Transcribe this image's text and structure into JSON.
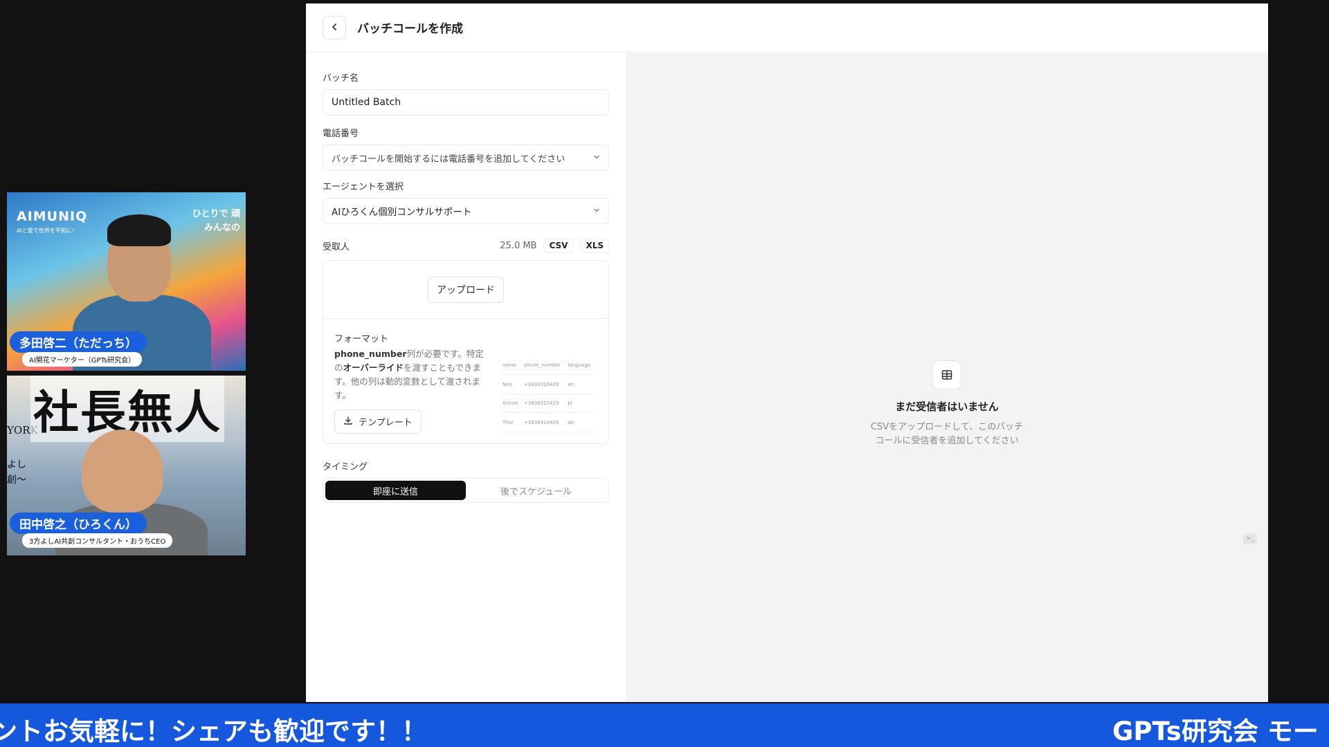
{
  "participants": [
    {
      "brand": "AIMUNIQ",
      "brand_sub": "AIと愛で世界を平和に!",
      "tagline_1": "ひとりで 頑",
      "tagline_2": "みんなの",
      "name": "多田啓二（ただっち）",
      "role": "AI開花マーケター（GPTs研究会）"
    },
    {
      "banner": "社長無人",
      "side_1": "YORK",
      "side_2": "よし",
      "side_3": "創〜",
      "name": "田中啓之（ひろくん）",
      "role": "3方よしAI共創コンサルタント・おうちCEO"
    }
  ],
  "app": {
    "back_icon": "chevron-left-icon",
    "title": "バッチコールを作成",
    "batch_name_label": "バッチ名",
    "batch_name_value": "Untitled Batch",
    "phone_label": "電話番号",
    "phone_placeholder": "バッチコールを開始するには電話番号を追加してください",
    "agent_label": "エージェントを選択",
    "agent_value": "AIひろくん個別コンサルサポート",
    "recipients_label": "受取人",
    "file_size": "25.0 MB",
    "csv_tag": "CSV",
    "xls_tag": "XLS",
    "upload_button": "アップロード",
    "format_title": "フォーマット",
    "format_desc_bold1": "phone_number",
    "format_desc_1": "列が必要です。特定の",
    "format_desc_bold2": "オーバーライド",
    "format_desc_2": "を渡すこともできます。他の列は動的変数として渡されます。",
    "template_button": "テンプレート",
    "sample_table": {
      "headers": [
        "name",
        "phone_number",
        "language"
      ],
      "rows": [
        [
          "Nev",
          "+3838310429",
          "en"
        ],
        [
          "Antoni",
          "+3838310429",
          "pl"
        ],
        [
          "Thor",
          "+3838310429",
          "de"
        ]
      ]
    },
    "timing_label": "タイミング",
    "timing_now": "即座に送信",
    "timing_later": "後でスケジュール",
    "empty_title": "まだ受信者はいません",
    "empty_desc_1": "CSVをアップロードして、このバッチ",
    "empty_desc_2": "コールに受信者を追加してください"
  },
  "ticker": {
    "left_text": "ントお気軽に！シェアも歓迎です！！",
    "right_text": "GPTs研究会 モー"
  }
}
